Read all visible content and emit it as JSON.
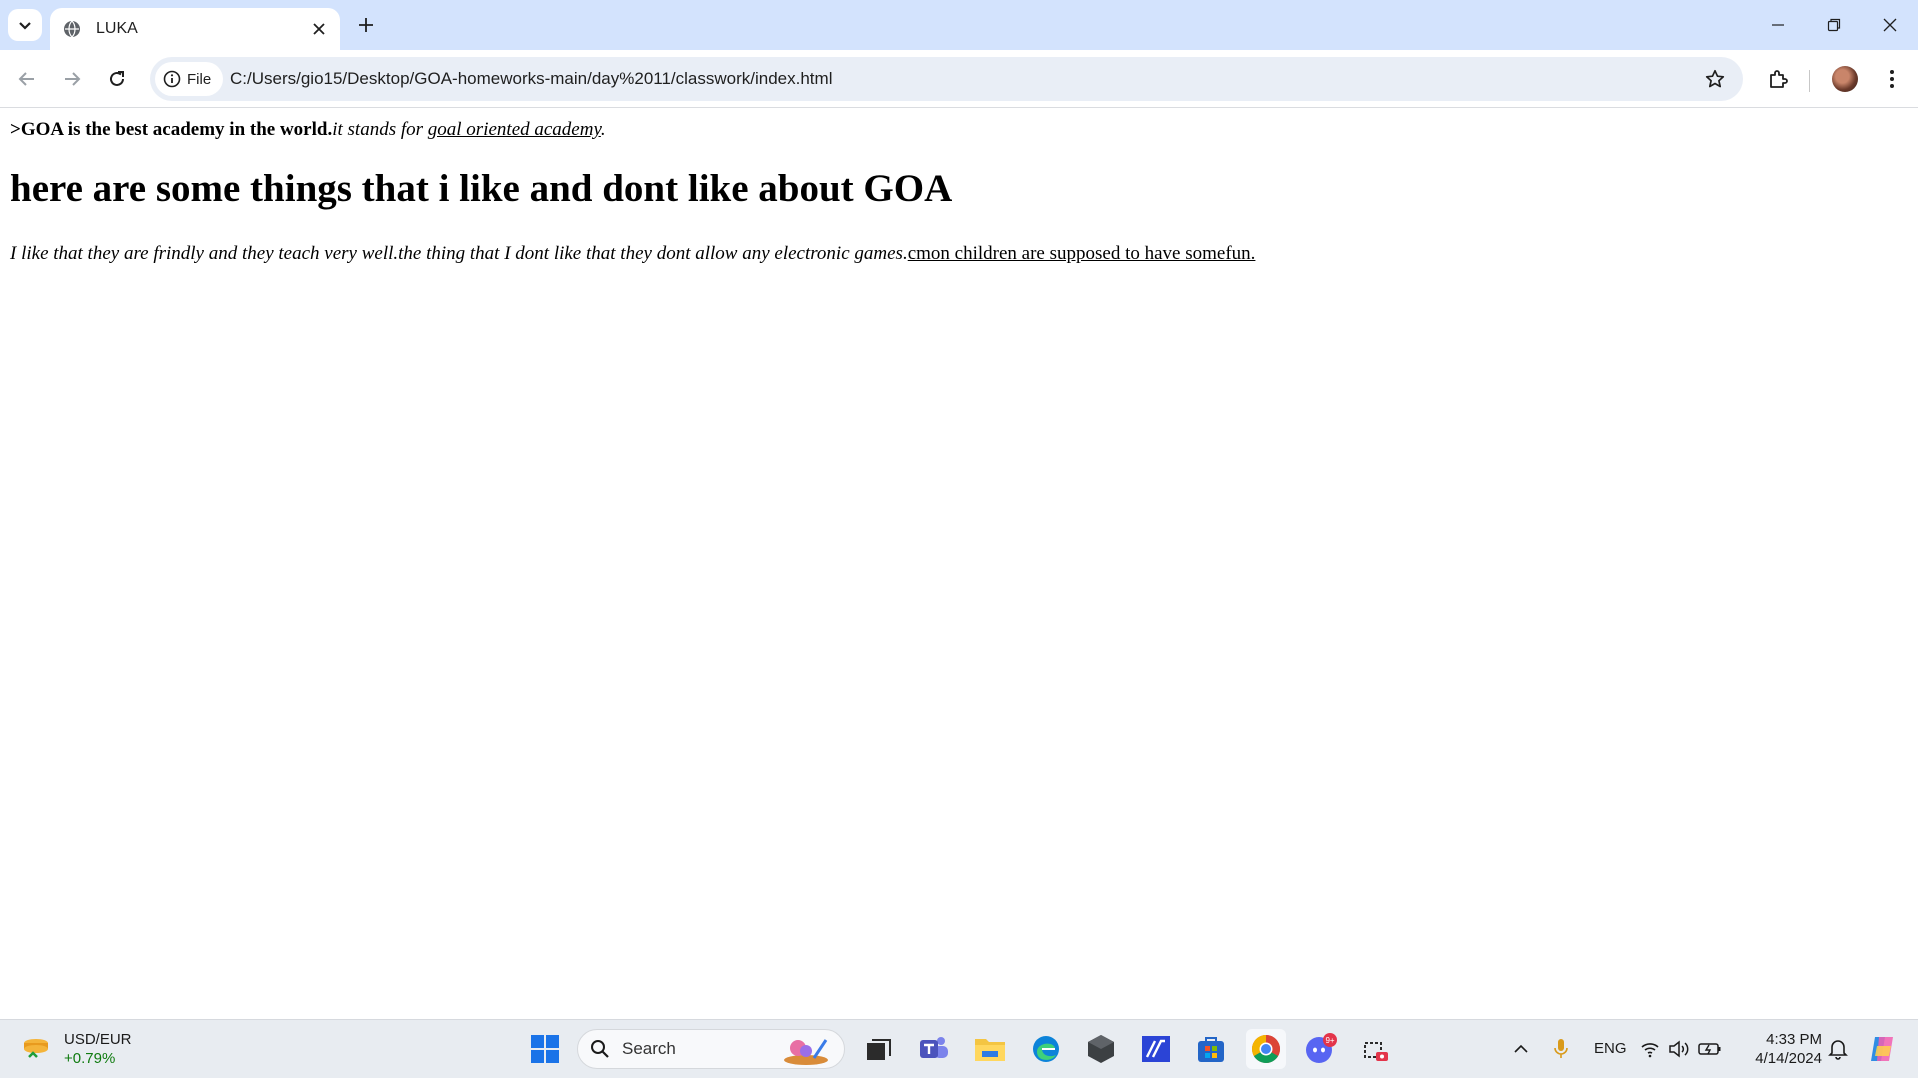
{
  "browser": {
    "tab": {
      "title": "LUKA",
      "favicon": "globe-icon"
    },
    "new_tab_icon": "plus-icon",
    "window_controls": [
      "minimize-icon",
      "restore-icon",
      "close-icon"
    ],
    "toolbar": {
      "back_icon": "back-arrow-icon",
      "forward_icon": "forward-arrow-icon",
      "reload_icon": "reload-icon",
      "site_chip": {
        "icon": "info-icon",
        "label": "File"
      },
      "url": "C:/Users/gio15/Desktop/GOA-homeworks-main/day%2011/classwork/index.html",
      "bookmark_icon": "star-icon",
      "extensions_icon": "puzzle-icon",
      "profile_icon": "avatar",
      "menu_icon": "kebab-menu-icon"
    }
  },
  "page": {
    "intro": {
      "bold": ">GOA is the best academy in the world.",
      "italic": "it stands for ",
      "italic_underline": "goal oriented academy",
      "end": "."
    },
    "heading": "here are some things that i like and dont like about GOA",
    "paragraph": {
      "italic": "I like that they are frindly and they teach very well.the thing that I dont like that they dont allow any electronic games.",
      "underline": "cmon children are supposed to have somefun."
    }
  },
  "taskbar": {
    "widget": {
      "title": "USD/EUR",
      "change": "+0.79%"
    },
    "search_placeholder": "Search",
    "apps": [
      "windows-start-icon",
      "search-icon",
      "task-view-icon",
      "teams-icon",
      "file-explorer-icon",
      "edge-icon",
      "app-icon",
      "app-icon",
      "store-icon",
      "chrome-icon",
      "discord-icon",
      "snipping-tool-icon"
    ],
    "discord_badge": "9+",
    "tray": {
      "language": "ENG"
    },
    "clock": {
      "time": "4:33 PM",
      "date": "4/14/2024"
    }
  },
  "colors": {
    "tabstrip": "#d3e3fd",
    "omnibox": "#e9eef6",
    "taskbar": "#e8ecf1",
    "widget_positive": "#0f7b0f"
  }
}
